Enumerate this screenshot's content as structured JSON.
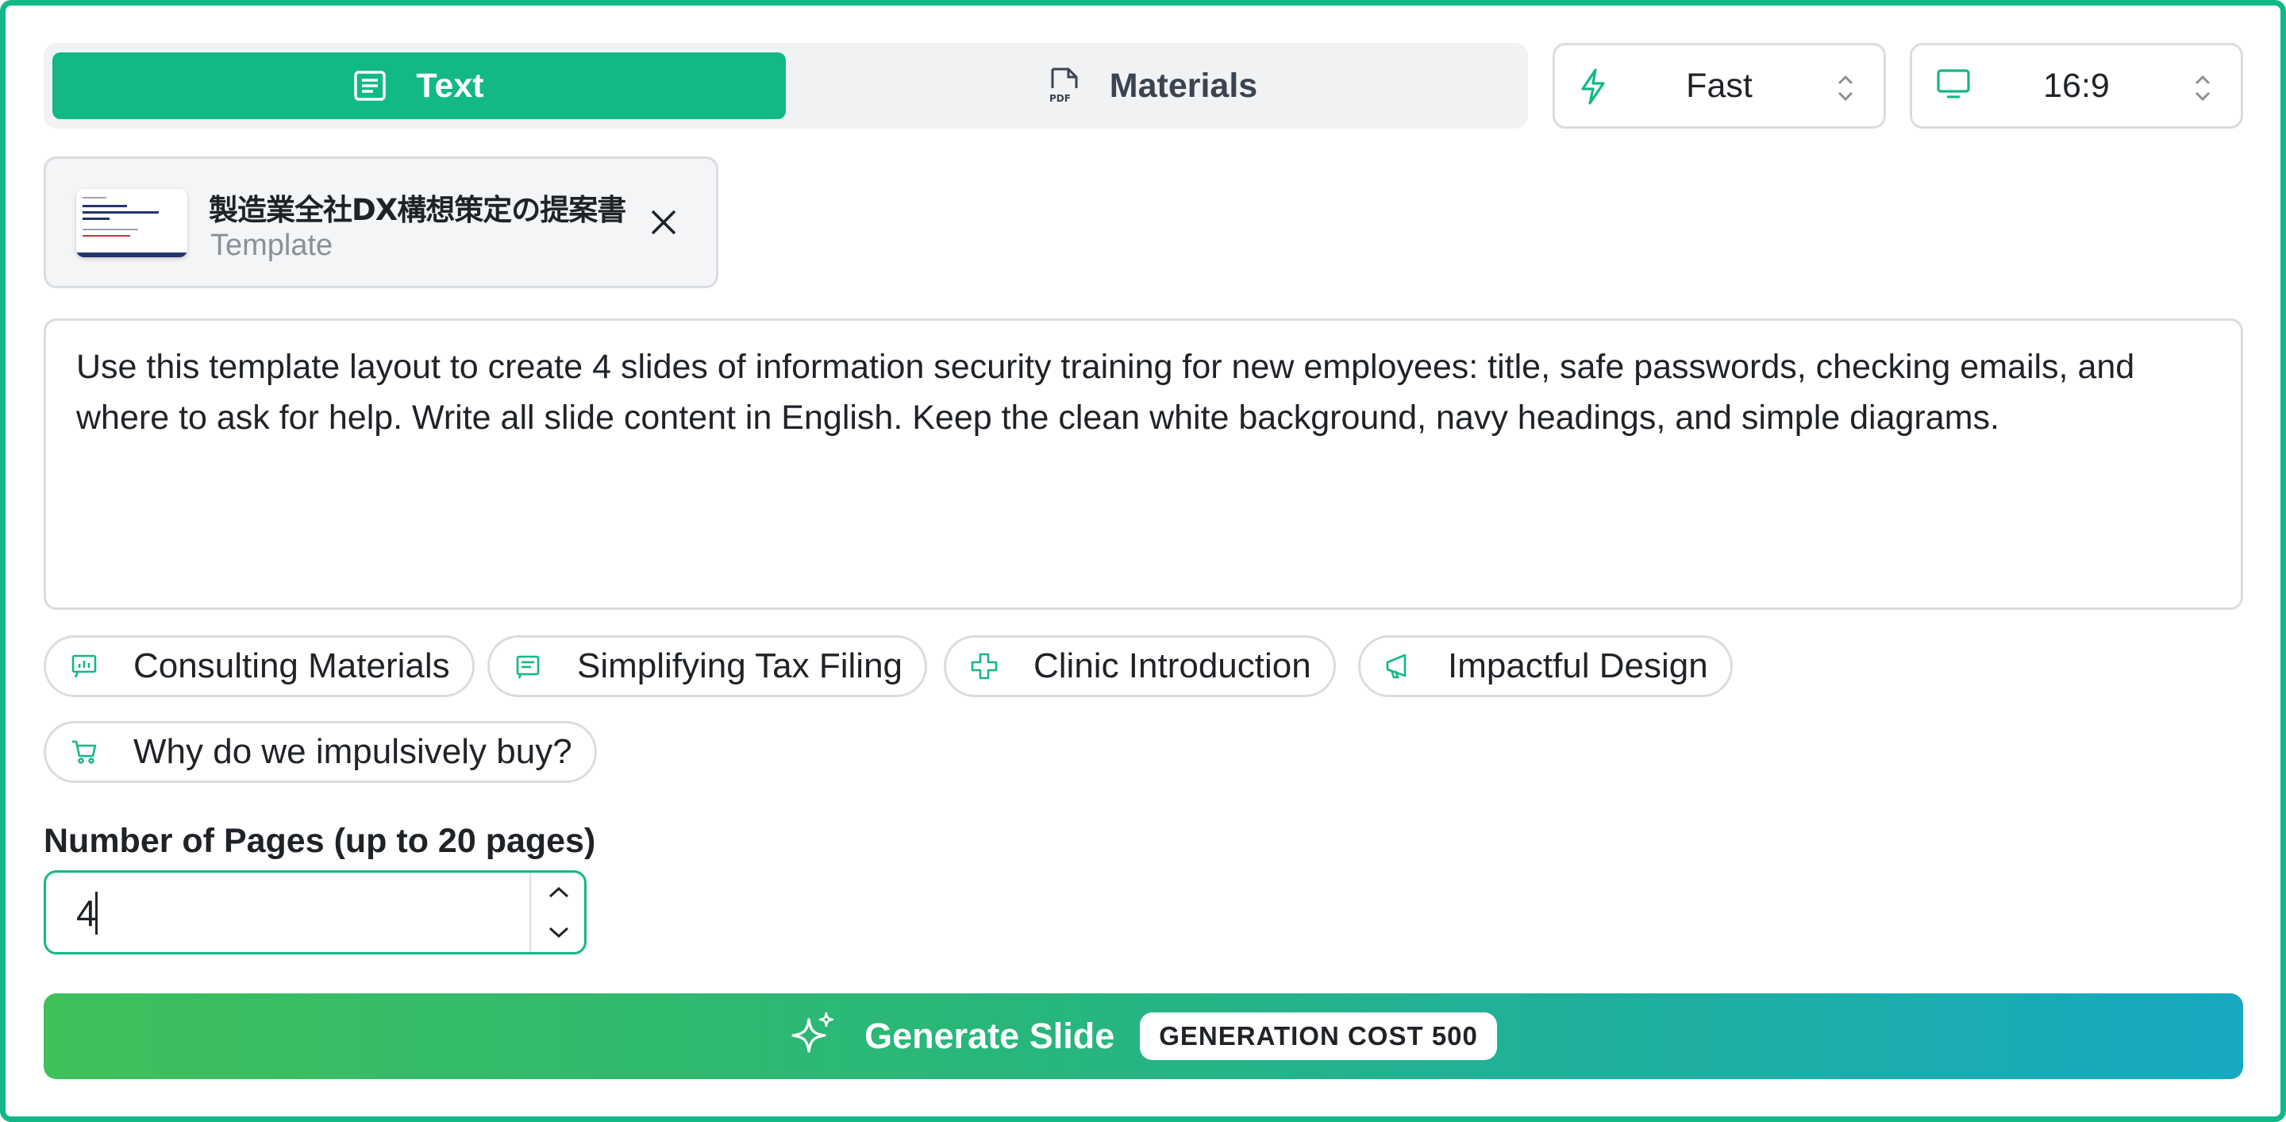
{
  "mode_tabs": {
    "text_label": "Text",
    "materials_label": "Materials",
    "selected": "Text"
  },
  "speed_select": {
    "value": "Fast",
    "icon": "lightning-icon"
  },
  "ratio_select": {
    "value": "16:9",
    "icon": "monitor-icon"
  },
  "template_chip": {
    "title": "製造業全社DX構想策定の提案書",
    "subtitle": "Template"
  },
  "prompt": {
    "value": "Use this template layout to create 4 slides of information security training for new employees: title, safe passwords, checking emails, and where to ask for help. Write all slide content in English. Keep the clean white background, navy headings, and simple diagrams."
  },
  "suggestions": [
    {
      "label": "Consulting Materials",
      "icon": "presentation-chart-icon"
    },
    {
      "label": "Simplifying Tax Filing",
      "icon": "receipt-icon"
    },
    {
      "label": "Clinic Introduction",
      "icon": "medical-cross-icon"
    },
    {
      "label": "Impactful Design",
      "icon": "megaphone-icon"
    },
    {
      "label": "Why do we impulsively buy?",
      "icon": "shopping-cart-icon"
    }
  ],
  "pages": {
    "label": "Number of Pages (up to 20 pages)",
    "value": "4"
  },
  "generate": {
    "label": "Generate Slide",
    "cost_badge": "GENERATION COST 500"
  },
  "colors": {
    "accent": "#13b887",
    "gradient_start": "#3ec05a",
    "gradient_end": "#16a9c1"
  }
}
